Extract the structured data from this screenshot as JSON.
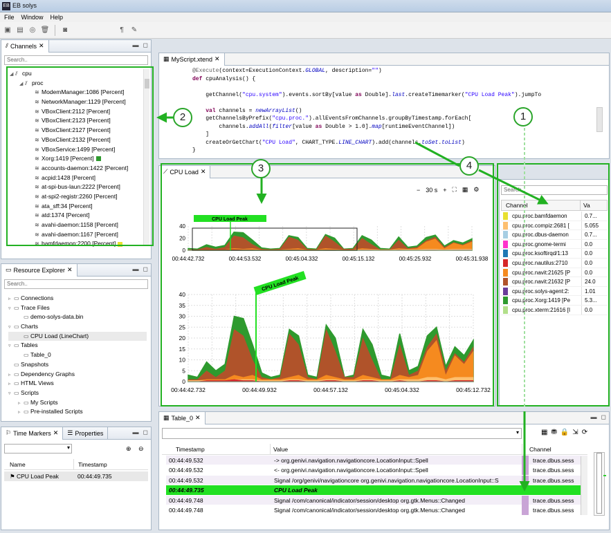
{
  "app": {
    "title": "EB solys",
    "logo": "EB"
  },
  "menu": [
    "File",
    "Window",
    "Help"
  ],
  "channels_view": {
    "tab": "Channels",
    "search_placeholder": "Search..",
    "tree": [
      {
        "label": "cpu",
        "level": 0
      },
      {
        "label": "proc",
        "level": 1
      },
      {
        "label": "ModemManager:1086 [Percent]",
        "level": 2
      },
      {
        "label": "NetworkManager:1129 [Percent]",
        "level": 2
      },
      {
        "label": "VBoxClient:2112 [Percent]",
        "level": 2
      },
      {
        "label": "VBoxClient:2123 [Percent]",
        "level": 2
      },
      {
        "label": "VBoxClient:2127 [Percent]",
        "level": 2
      },
      {
        "label": "VBoxClient:2132 [Percent]",
        "level": 2
      },
      {
        "label": "VBoxService:1499 [Percent]",
        "level": 2
      },
      {
        "label": "Xorg:1419 [Percent]",
        "level": 2,
        "swatch": "#2e9a2e"
      },
      {
        "label": "accounts-daemon:1422 [Percent]",
        "level": 2
      },
      {
        "label": "acpid:1428 [Percent]",
        "level": 2
      },
      {
        "label": "at-spi-bus-laun:2222 [Percent]",
        "level": 2
      },
      {
        "label": "at-spi2-registr:2260 [Percent]",
        "level": 2
      },
      {
        "label": "ata_sff:34 [Percent]",
        "level": 2
      },
      {
        "label": "atd:1374 [Percent]",
        "level": 2
      },
      {
        "label": "avahi-daemon:1158 [Percent]",
        "level": 2
      },
      {
        "label": "avahi-daemon:1167 [Percent]",
        "level": 2
      },
      {
        "label": "bamfdaemon:2200 [Percent]",
        "level": 2,
        "swatch": "#e8e030"
      }
    ]
  },
  "resource_explorer": {
    "tab": "Resource Explorer",
    "search_placeholder": "Search..",
    "tree": [
      {
        "label": "Connections",
        "level": 0,
        "exp": "▹"
      },
      {
        "label": "Trace Files",
        "level": 0,
        "exp": "▿"
      },
      {
        "label": "demo-solys-data.bin",
        "level": 1,
        "exp": ""
      },
      {
        "label": "Charts",
        "level": 0,
        "exp": "▿"
      },
      {
        "label": "CPU Load (LineChart)",
        "level": 1,
        "exp": "",
        "sel": true
      },
      {
        "label": "Tables",
        "level": 0,
        "exp": "▿"
      },
      {
        "label": "Table_0",
        "level": 1,
        "exp": ""
      },
      {
        "label": "Snapshots",
        "level": 0,
        "exp": ""
      },
      {
        "label": "Dependency Graphs",
        "level": 0,
        "exp": "▹"
      },
      {
        "label": "HTML Views",
        "level": 0,
        "exp": "▹"
      },
      {
        "label": "Scripts",
        "level": 0,
        "exp": "▿"
      },
      {
        "label": "My Scripts",
        "level": 1,
        "exp": "▹"
      },
      {
        "label": "Pre-installed Scripts",
        "level": 1,
        "exp": "▹"
      }
    ]
  },
  "markers_view": {
    "tab1": "Time Markers",
    "tab2": "Properties",
    "col_name": "Name",
    "col_timestamp": "Timestamp",
    "row_name": "CPU Load Peak",
    "row_timestamp": "00:44:49.735"
  },
  "editor": {
    "tab": "MyScript.xtend"
  },
  "chart_view": {
    "tab": "CPU Load",
    "window": "30 s",
    "minus": "−",
    "plus": "+",
    "marker": "CPU Load Peak"
  },
  "chart_data": [
    {
      "type": "area",
      "title": "",
      "xlabel": "",
      "ylabel": "",
      "ylim": [
        0,
        40
      ],
      "yticks": [
        0,
        10,
        20,
        30,
        40
      ],
      "x": [
        "00:44:42.732",
        "00:44:53.532",
        "00:45:04.332",
        "00:45:15.132",
        "00:45:25.932",
        "00:45:31.938"
      ],
      "annotations": [
        "CPU Load Peak"
      ]
    },
    {
      "type": "area",
      "title": "",
      "xlabel": "",
      "ylabel": "",
      "ylim": [
        0,
        40
      ],
      "yticks": [
        0,
        5,
        10,
        15,
        20,
        25,
        30,
        35,
        40
      ],
      "x": [
        "00:44:42.732",
        "00:44:49.932",
        "00:44:57.132",
        "00:45:04.332",
        "00:45:12.732"
      ],
      "annotations": [
        "CPU Load Peak"
      ],
      "series": [
        {
          "color": "#2e9a2e",
          "values": [
            3,
            2,
            9,
            5,
            8,
            30,
            29,
            17,
            4,
            2,
            3,
            24,
            21,
            3,
            2,
            26,
            20,
            2,
            3,
            24,
            17,
            3,
            2,
            22,
            5,
            7,
            21,
            25,
            7,
            16,
            12,
            19
          ]
        },
        {
          "color": "#b0532a",
          "values": [
            1,
            1,
            5,
            2,
            5,
            24,
            21,
            10,
            2,
            1,
            2,
            22,
            17,
            2,
            1,
            24,
            14,
            2,
            2,
            20,
            10,
            1,
            1,
            17,
            3,
            5,
            16,
            22,
            5,
            13,
            9,
            16
          ]
        },
        {
          "color": "#f58a1f",
          "values": [
            0.5,
            0.5,
            1,
            1,
            1,
            3,
            2,
            3,
            1,
            1,
            1,
            2,
            3,
            1,
            1,
            3,
            2,
            1,
            1,
            3,
            2,
            1,
            1,
            3,
            2,
            3,
            14,
            19,
            3,
            12,
            8,
            14
          ]
        },
        {
          "color": "#fdbf6f",
          "values": [
            0.5,
            0.5,
            0.5,
            0.5,
            0.5,
            1,
            1,
            1,
            0.5,
            0.5,
            0.5,
            1,
            1,
            0.5,
            0.5,
            1,
            1,
            0.5,
            0.5,
            1,
            1,
            0.5,
            0.5,
            1,
            1,
            1,
            2,
            2,
            1,
            2,
            2,
            2
          ]
        },
        {
          "color": "#d62728",
          "values": [
            0,
            0,
            0.5,
            0.5,
            0.5,
            1,
            0.5,
            0.5,
            0,
            0,
            0,
            0.5,
            0.5,
            0,
            0,
            0.5,
            0.5,
            0,
            0,
            0.5,
            0.5,
            0,
            0,
            0.5,
            0,
            0,
            0.5,
            0.5,
            0,
            0.5,
            0.5,
            0.5
          ]
        }
      ]
    }
  ],
  "channel_table": {
    "search_placeholder": "Search..",
    "col_channel": "Channel",
    "col_value": "Va",
    "rows": [
      {
        "color": "#e8e030",
        "name": "cpu.proc.bamfdaemon",
        "value": "0.7..."
      },
      {
        "color": "#fdbf6f",
        "name": "cpu.proc.compiz:2681 [",
        "value": "5.055"
      },
      {
        "color": "#a6cee3",
        "name": "cpu.proc.dbus-daemon",
        "value": "0.7..."
      },
      {
        "color": "#ff33cc",
        "name": "cpu.proc.gnome-termi",
        "value": "0.0"
      },
      {
        "color": "#1f78b4",
        "name": "cpu.proc.ksoftirqd/1:13",
        "value": "0.0"
      },
      {
        "color": "#d62728",
        "name": "cpu.proc.nautilus:2710",
        "value": "0.0"
      },
      {
        "color": "#f58a1f",
        "name": "cpu.proc.navit:21625 [P",
        "value": "0.0"
      },
      {
        "color": "#b0532a",
        "name": "cpu.proc.navit:21632 [P",
        "value": "24.0"
      },
      {
        "color": "#6a3d9a",
        "name": "cpu.proc.solys-agent:2:",
        "value": "1.01"
      },
      {
        "color": "#2e9a2e",
        "name": "cpu.proc.Xorg:1419 [Pe",
        "value": "5.3..."
      },
      {
        "color": "#b2df8a",
        "name": "cpu.proc.xterm:21616 [I",
        "value": "0.0"
      }
    ]
  },
  "table_view": {
    "tab": "Table_0",
    "col_timestamp": "Timestamp",
    "col_value": "Value",
    "col_channel": "Channel",
    "rows": [
      {
        "ts": "00:44:49.532",
        "val": "-> org.genivi.navigation.navigationcore.LocationInput::Spell",
        "ch": "trace.dbus.sess"
      },
      {
        "ts": "00:44:49.532",
        "val": "<- org.genivi.navigation.navigationcore.LocationInput::Spell",
        "ch": "trace.dbus.sess"
      },
      {
        "ts": "00:44:49.532",
        "val": "Signal /org/genivi/navigationcore org.genivi.navigation.navigationcore.LocationInput::S",
        "ch": "trace.dbus.sess"
      },
      {
        "ts": "00:44:49.735",
        "val": "CPU Load Peak",
        "ch": "",
        "hl": true
      },
      {
        "ts": "00:44:49.748",
        "val": "Signal /com/canonical/indicator/session/desktop org.gtk.Menus::Changed",
        "ch": "trace.dbus.sess"
      },
      {
        "ts": "00:44:49.748",
        "val": "Signal /com/canonical/indicator/session/desktop org.gtk.Menus::Changed",
        "ch": "trace.dbus.sess"
      }
    ]
  },
  "callouts": [
    "1",
    "2",
    "3",
    "4"
  ]
}
